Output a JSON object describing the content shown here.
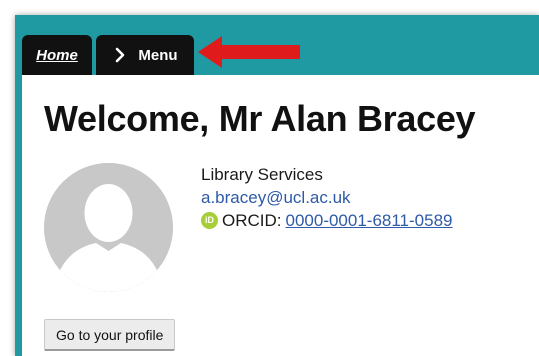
{
  "tabs": {
    "home_label": "Home",
    "menu_label": "Menu"
  },
  "welcome": {
    "title": "Welcome, Mr Alan Bracey"
  },
  "user": {
    "department": "Library Services",
    "email": "a.bracey@ucl.ac.uk",
    "orcid_label": "ORCID:",
    "orcid_id": "0000-0001-6811-0589",
    "orcid_badge": "iD"
  },
  "actions": {
    "profile_button": "Go to your profile"
  },
  "colors": {
    "frame": "#1f9aa3",
    "tab": "#111111",
    "arrow": "#e01b1b",
    "link": "#2e5aa7",
    "orcid": "#a6ce39"
  },
  "icons": {
    "menu_chevron": "chevron-right-icon",
    "annotation": "red-arrow-icon",
    "avatar": "person-silhouette-icon",
    "orcid": "orcid-icon"
  }
}
